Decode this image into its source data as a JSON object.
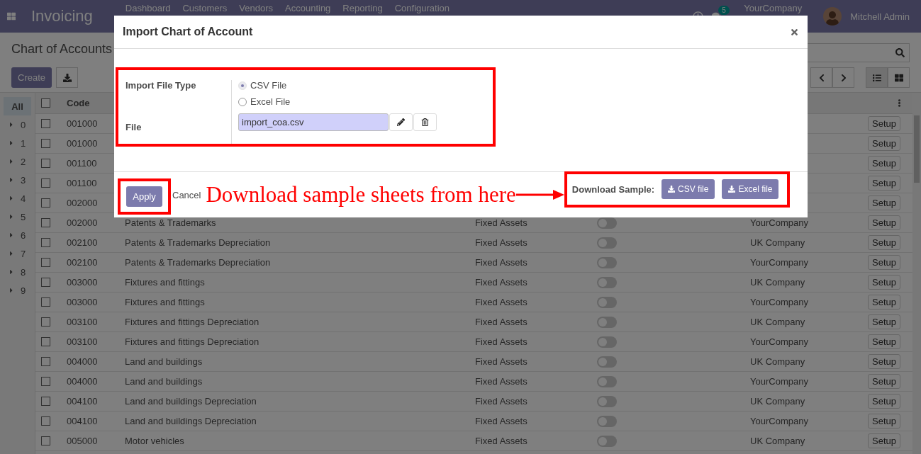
{
  "navbar": {
    "app_title": "Invoicing",
    "menu": [
      "Dashboard",
      "Customers",
      "Vendors",
      "Accounting",
      "Reporting",
      "Configuration"
    ],
    "chat_badge": "5",
    "company": "YourCompany",
    "user": "Mitchell Admin"
  },
  "control_panel": {
    "breadcrumb": "Chart of Accounts",
    "create_label": "Create",
    "view_buttons": [
      {
        "kind": "list",
        "selected": true
      },
      {
        "kind": "kanban",
        "selected": false
      }
    ]
  },
  "sidebar": {
    "items": [
      {
        "label": "All",
        "selected": true
      },
      {
        "label": "0",
        "selected": false,
        "expanded": false
      },
      {
        "label": "1",
        "selected": false,
        "expanded": false
      },
      {
        "label": "2",
        "selected": false,
        "expanded": false
      },
      {
        "label": "3",
        "selected": false,
        "expanded": false
      },
      {
        "label": "4",
        "selected": false,
        "expanded": false
      },
      {
        "label": "5",
        "selected": false,
        "expanded": false
      },
      {
        "label": "6",
        "selected": false,
        "expanded": false
      },
      {
        "label": "7",
        "selected": false,
        "expanded": false
      },
      {
        "label": "8",
        "selected": false,
        "expanded": false
      },
      {
        "label": "9",
        "selected": false,
        "expanded": false
      }
    ]
  },
  "table": {
    "all_checked": false,
    "code_heading": "Code",
    "rows": [
      {
        "checked": false,
        "code": "001000",
        "setup": "Setup"
      },
      {
        "checked": false,
        "code": "001000",
        "setup": "Setup"
      },
      {
        "checked": false,
        "code": "001100",
        "setup": "Setup"
      },
      {
        "checked": false,
        "code": "001100",
        "setup": "Setup"
      },
      {
        "checked": false,
        "code": "002000",
        "setup": "Setup"
      },
      {
        "checked": false,
        "code": "002000",
        "name": "Patents & Trademarks",
        "type": "Fixed Assets",
        "on": false,
        "company": "YourCompany",
        "setup": "Setup"
      },
      {
        "checked": false,
        "code": "002100",
        "name": "Patents & Trademarks Depreciation",
        "type": "Fixed Assets",
        "on": false,
        "company": "UK Company",
        "setup": "Setup"
      },
      {
        "checked": false,
        "code": "002100",
        "name": "Patents & Trademarks Depreciation",
        "type": "Fixed Assets",
        "on": false,
        "company": "YourCompany",
        "setup": "Setup"
      },
      {
        "checked": false,
        "code": "003000",
        "name": "Fixtures and fittings",
        "type": "Fixed Assets",
        "on": false,
        "company": "UK Company",
        "setup": "Setup"
      },
      {
        "checked": false,
        "code": "003000",
        "name": "Fixtures and fittings",
        "type": "Fixed Assets",
        "on": false,
        "company": "YourCompany",
        "setup": "Setup"
      },
      {
        "checked": false,
        "code": "003100",
        "name": "Fixtures and fittings Depreciation",
        "type": "Fixed Assets",
        "on": false,
        "company": "UK Company",
        "setup": "Setup"
      },
      {
        "checked": false,
        "code": "003100",
        "name": "Fixtures and fittings Depreciation",
        "type": "Fixed Assets",
        "on": false,
        "company": "YourCompany",
        "setup": "Setup"
      },
      {
        "checked": false,
        "code": "004000",
        "name": "Land and buildings",
        "type": "Fixed Assets",
        "on": false,
        "company": "UK Company",
        "setup": "Setup"
      },
      {
        "checked": false,
        "code": "004000",
        "name": "Land and buildings",
        "type": "Fixed Assets",
        "on": false,
        "company": "YourCompany",
        "setup": "Setup"
      },
      {
        "checked": false,
        "code": "004100",
        "name": "Land and buildings Depreciation",
        "type": "Fixed Assets",
        "on": false,
        "company": "UK Company",
        "setup": "Setup"
      },
      {
        "checked": false,
        "code": "004100",
        "name": "Land and buildings Depreciation",
        "type": "Fixed Assets",
        "on": false,
        "company": "YourCompany",
        "setup": "Setup"
      },
      {
        "checked": false,
        "code": "005000",
        "name": "Motor vehicles",
        "type": "Fixed Assets",
        "on": false,
        "company": "UK Company",
        "setup": "Setup"
      }
    ]
  },
  "dialog": {
    "title": "Import Chart of Account",
    "file_type_label": "Import File Type",
    "file_types": [
      {
        "label": "CSV File",
        "selected": true
      },
      {
        "label": "Excel File",
        "selected": false
      }
    ],
    "file_label": "File",
    "file_value": "import_coa.csv",
    "apply_label": "Apply",
    "cancel_label": "Cancel",
    "annotation": "Download sample sheets from here",
    "download_label": "Download Sample:",
    "download_buttons": [
      "CSV file",
      "Excel file"
    ]
  }
}
